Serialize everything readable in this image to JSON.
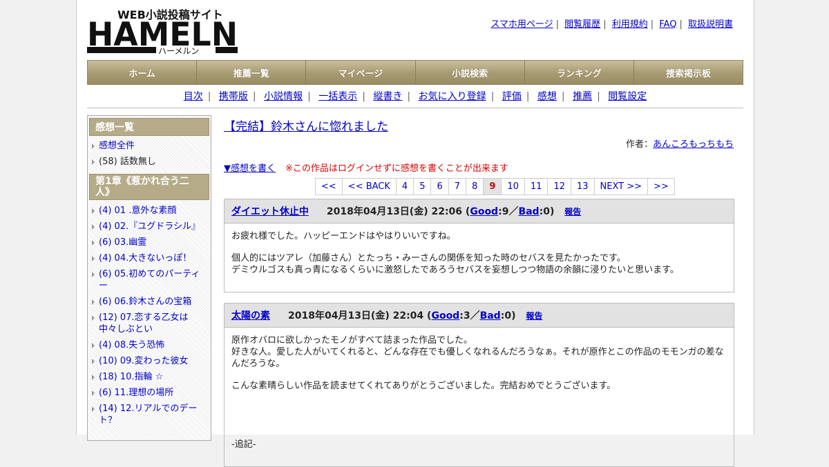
{
  "logo": {
    "tagline": "WEB小説投稿サイト",
    "word": "HAMELN",
    "kana": "ハーメルン"
  },
  "toplinks": [
    "スマホ用ページ",
    "閲覧履歴",
    "利用規約",
    "FAQ",
    "取扱説明書"
  ],
  "nav": [
    "ホーム",
    "推薦一覧",
    "マイページ",
    "小説検索",
    "ランキング",
    "捜索掲示板"
  ],
  "subnav": [
    "目次",
    "携帯版",
    "小説情報",
    "一括表示",
    "縦書き",
    "お気に入り登録",
    "評価",
    "感想",
    "推薦",
    "閲覧設定"
  ],
  "sidebar": {
    "heading": "感想一覧",
    "all": "感想全件",
    "no_episode": "(58) 話数無し",
    "chapter": "第1章《惹かれ合う二人》",
    "items": [
      "(4) 01 .意外な素顔",
      "(4) 02.『ユグドラシル』",
      "(6) 03.幽霊",
      "(4) 04.大きないっぽ！",
      "(6) 05.初めてのパーティー",
      "(6) 06.鈴木さんの宝箱",
      "(12) 07.恋する乙女は中々しぶとい",
      "(4) 08.失う恐怖",
      "(10) 09.変わった彼女",
      "(18) 10.指輪 ☆",
      "(6) 11.理想の場所",
      "(14) 12.リアルでのデート？"
    ]
  },
  "main": {
    "title": "【完結】鈴木さんに惚れました",
    "author_label": "作者：",
    "author": "あんころもっちもち",
    "write_link": "▼感想を書く",
    "write_note": "※この作品はログインせずに感想を書くことが出来ます"
  },
  "pager": [
    "<<",
    "<< BACK",
    "4",
    "5",
    "6",
    "7",
    "8",
    "9",
    "10",
    "11",
    "12",
    "13",
    "NEXT >>",
    ">>"
  ],
  "pager_current": "9",
  "reviews": [
    {
      "name": "ダイエット休止中",
      "date": "2018年04月13日(金) 22:06",
      "good": "9",
      "bad": "0",
      "report": "報告",
      "paragraphs": [
        "お疲れ様でした。ハッピーエンドはやはりいいですね。",
        "個人的にはツアレ（加藤さん）とたっち・みーさんの関係を知った時のセバスを見たかったです。\nデミウルゴスも真っ青になるくらいに激怒したであろうセバスを妄想しつつ物語の余韻に浸りたいと思います。"
      ]
    },
    {
      "name": "太陽の素",
      "date": "2018年04月13日(金) 22:04",
      "good": "3",
      "bad": "0",
      "report": "報告",
      "paragraphs": [
        "原作オバロに欲しかったモノがすべて詰まった作品でした。\n好きな人。愛した人がいてくれると、どんな存在でも優しくなれるんだろうなぁ。それが原作とこの作品のモモンガの差なんだろうな。",
        "こんな素晴らしい作品を読ませてくれてありがとうございました。完結おめでとうございます。",
        "",
        "",
        "-追記-"
      ]
    }
  ],
  "labels": {
    "good": "Good",
    "bad": "Bad"
  }
}
